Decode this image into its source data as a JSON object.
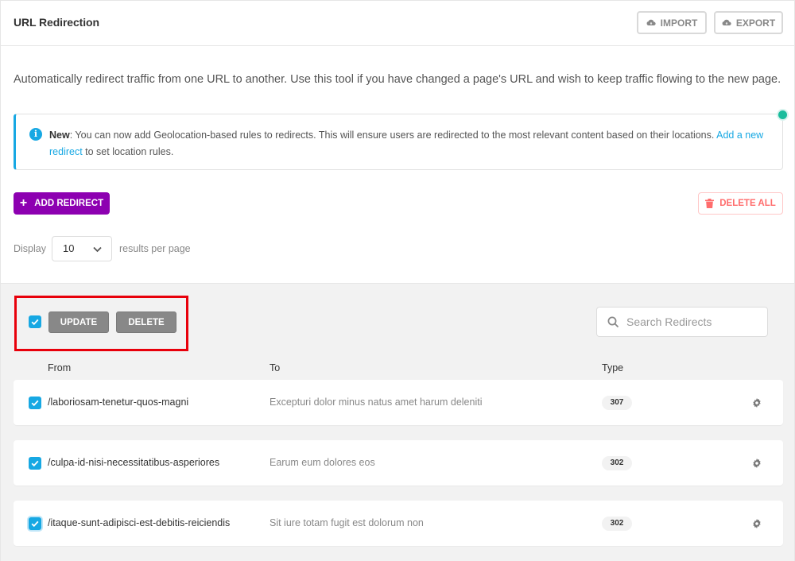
{
  "header": {
    "title": "URL Redirection",
    "import_label": "IMPORT",
    "export_label": "EXPORT"
  },
  "description": "Automatically redirect traffic from one URL to another. Use this tool if you have changed a page's URL and wish to keep traffic flowing to the new page.",
  "notice": {
    "lead": "New",
    "text": ": You can now add Geolocation-based rules to redirects. This will ensure users are redirected to the most relevant content based on their locations. ",
    "link": "Add a new redirect",
    "tail": " to set location rules."
  },
  "actions": {
    "add_label": "ADD REDIRECT",
    "delete_all_label": "DELETE ALL"
  },
  "display": {
    "label": "Display",
    "value": "10",
    "suffix": "results per page"
  },
  "bulk": {
    "update_label": "UPDATE",
    "delete_label": "DELETE",
    "checked": true
  },
  "search": {
    "placeholder": "Search Redirects"
  },
  "table": {
    "headers": {
      "from": "From",
      "to": "To",
      "type": "Type"
    },
    "rows": [
      {
        "from": "/laboriosam-tenetur-quos-magni",
        "to": "Excepturi dolor minus natus amet harum deleniti",
        "type": "307",
        "checked": true
      },
      {
        "from": "/culpa-id-nisi-necessitatibus-asperiores",
        "to": "Earum eum dolores eos",
        "type": "302",
        "checked": true
      },
      {
        "from": "/itaque-sunt-adipisci-est-debitis-reiciendis",
        "to": "Sit iure totam fugit est dolorum non",
        "type": "302",
        "checked": true
      }
    ]
  },
  "colors": {
    "accent_blue": "#17a8e3",
    "purple": "#8d00b1",
    "danger": "#ff6d6d",
    "highlight_red": "#e8000b",
    "status_green": "#1abc9c"
  }
}
